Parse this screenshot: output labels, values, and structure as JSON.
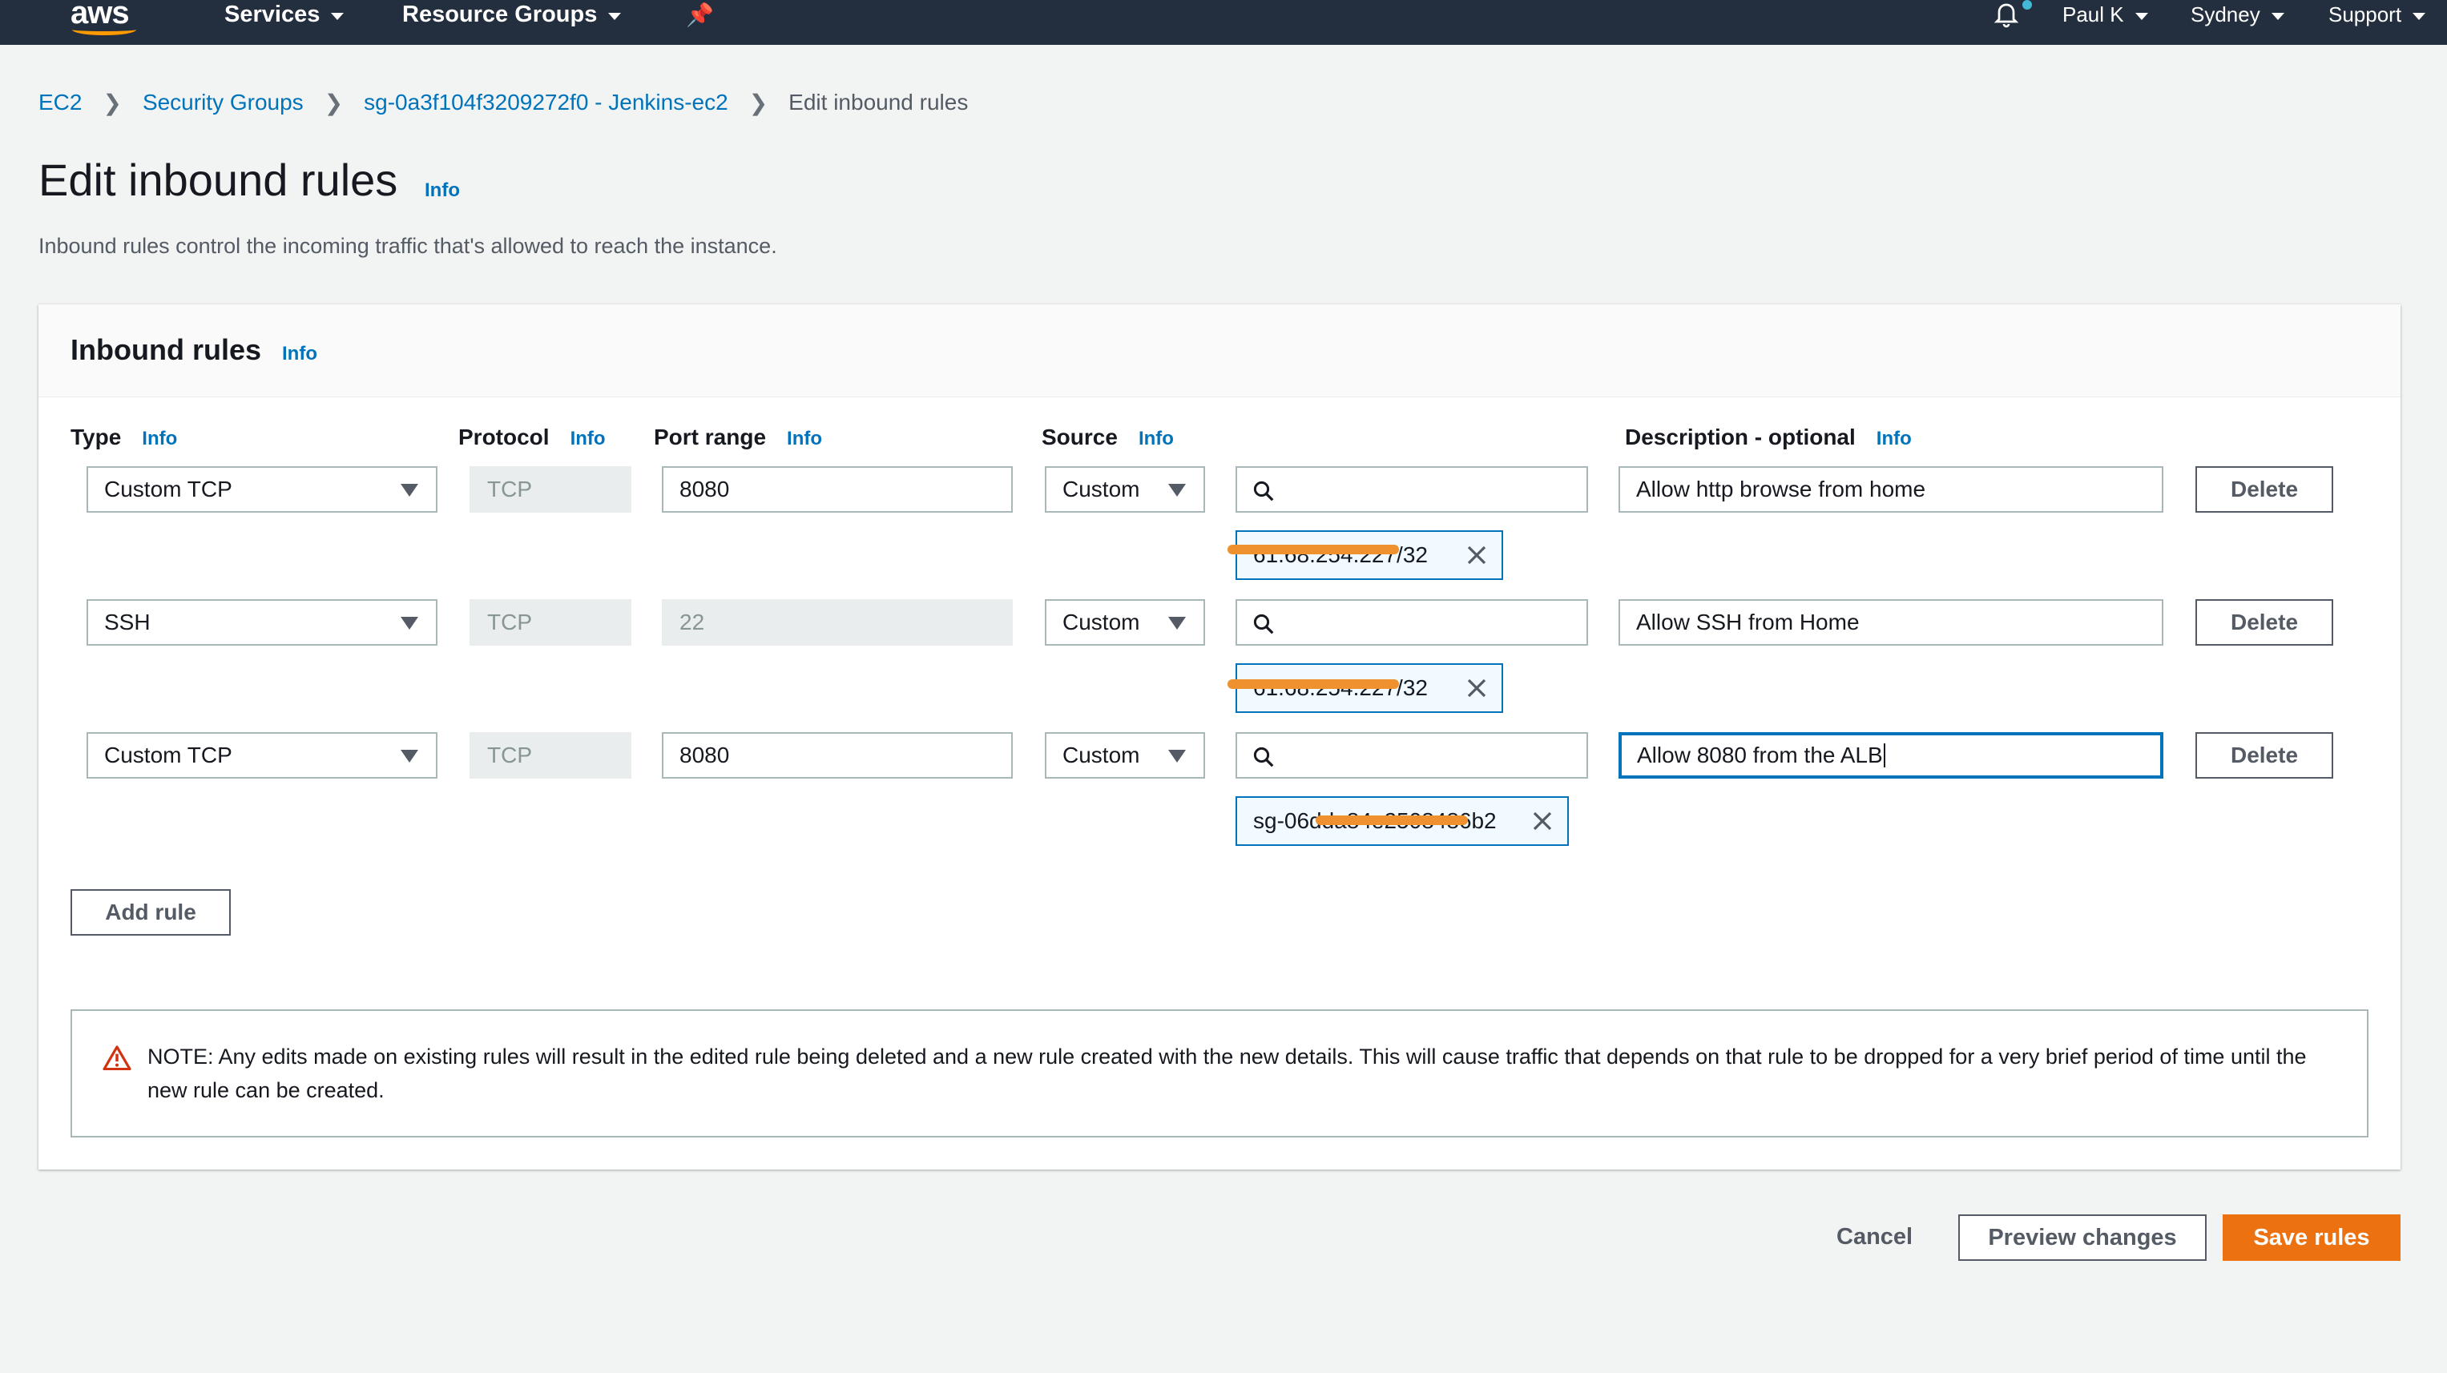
{
  "nav": {
    "logo": "aws",
    "services": "Services",
    "resource_groups": "Resource Groups",
    "user": "Paul K",
    "region": "Sydney",
    "support": "Support"
  },
  "breadcrumb": {
    "ec2": "EC2",
    "security_groups": "Security Groups",
    "sg": "sg-0a3f104f3209272f0 - Jenkins-ec2",
    "current": "Edit inbound rules"
  },
  "page": {
    "title": "Edit inbound rules",
    "info": "Info",
    "subtitle": "Inbound rules control the incoming traffic that's allowed to reach the instance."
  },
  "panel": {
    "title": "Inbound rules",
    "info": "Info",
    "columns": {
      "type": "Type",
      "protocol": "Protocol",
      "port_range": "Port range",
      "source": "Source",
      "description": "Description - optional"
    },
    "rules": [
      {
        "type": "Custom TCP",
        "protocol": "TCP",
        "port": "8080",
        "source": "Custom",
        "search": "",
        "token": "61.68.254.227/32",
        "description": "Allow http browse from home",
        "delete": "Delete"
      },
      {
        "type": "SSH",
        "protocol": "TCP",
        "port": "22",
        "source": "Custom",
        "search": "",
        "token": "61.68.254.227/32",
        "description": "Allow SSH from Home",
        "delete": "Delete"
      },
      {
        "type": "Custom TCP",
        "protocol": "TCP",
        "port": "8080",
        "source": "Custom",
        "search": "",
        "token": "sg-06dda84e2508486b2",
        "description": "Allow 8080 from the ALB",
        "delete": "Delete"
      }
    ],
    "add_rule": "Add rule",
    "note": "NOTE: Any edits made on existing rules will result in the edited rule being deleted and a new rule created with the new details. This will cause traffic that depends on that rule to be dropped for a very brief period of time until the new rule can be created."
  },
  "footer": {
    "cancel": "Cancel",
    "preview": "Preview changes",
    "save": "Save rules"
  },
  "colors": {
    "nav_bg": "#232f3e",
    "link": "#0073bb",
    "primary": "#ec7211",
    "redaction": "#f0912f"
  }
}
